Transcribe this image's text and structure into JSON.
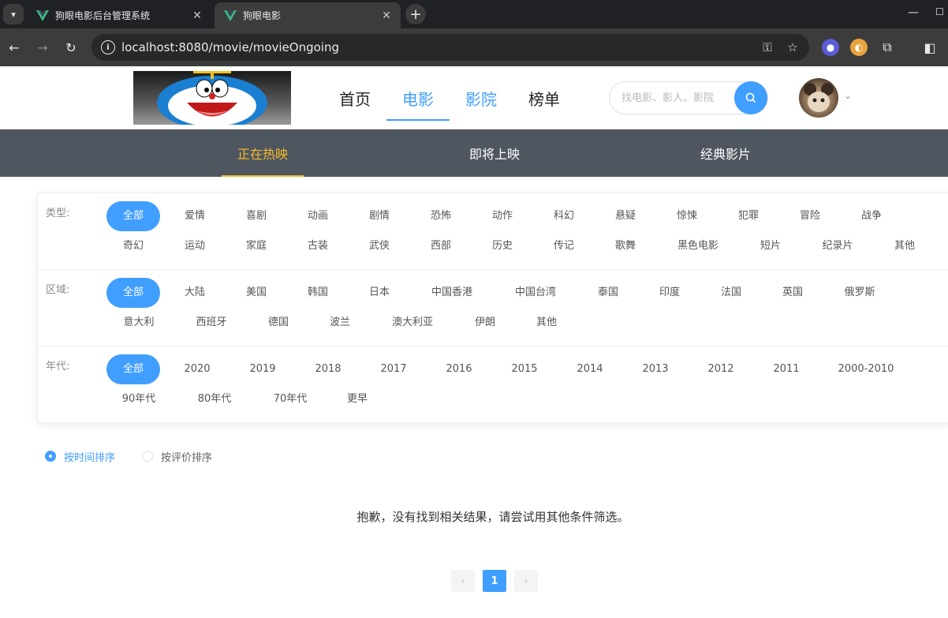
{
  "browser": {
    "tabs": [
      {
        "title": "狗眼电影后台管理系统",
        "active": false
      },
      {
        "title": "狗眼电影",
        "active": true
      }
    ],
    "url": "localhost:8080/movie/movieOngoing",
    "icons": [
      "tab-search-icon",
      "vue-logo-icon",
      "close-icon",
      "new-tab-icon",
      "back-icon",
      "forward-icon",
      "reload-icon",
      "site-info-icon",
      "password-key-icon",
      "bookmark-star-icon",
      "extensions-icon",
      "side-panel-icon"
    ]
  },
  "header": {
    "nav": [
      {
        "label": "首页",
        "state": "normal"
      },
      {
        "label": "电影",
        "state": "active"
      },
      {
        "label": "影院",
        "state": "blue"
      },
      {
        "label": "榜单",
        "state": "normal"
      }
    ],
    "search_placeholder": "找电影、影人、影院"
  },
  "sub_nav": [
    {
      "label": "正在热映",
      "active": true
    },
    {
      "label": "即将上映",
      "active": false
    },
    {
      "label": "经典影片",
      "active": false
    }
  ],
  "filters": {
    "type": {
      "label": "类型:",
      "tags": [
        "全部",
        "爱情",
        "喜剧",
        "动画",
        "剧情",
        "恐怖",
        "动作",
        "科幻",
        "悬疑",
        "惊悚",
        "犯罪",
        "冒险",
        "战争",
        "奇幻",
        "运动",
        "家庭",
        "古装",
        "武侠",
        "西部",
        "历史",
        "传记",
        "歌舞",
        "黑色电影",
        "短片",
        "纪录片",
        "其他"
      ],
      "selected": "全部"
    },
    "region": {
      "label": "区域:",
      "tags": [
        "全部",
        "大陆",
        "美国",
        "韩国",
        "日本",
        "中国香港",
        "中国台湾",
        "泰国",
        "印度",
        "法国",
        "英国",
        "俄罗斯",
        "意大利",
        "西班牙",
        "德国",
        "波兰",
        "澳大利亚",
        "伊朗",
        "其他"
      ],
      "selected": "全部"
    },
    "year": {
      "label": "年代:",
      "tags": [
        "全部",
        "2020",
        "2019",
        "2018",
        "2017",
        "2016",
        "2015",
        "2014",
        "2013",
        "2012",
        "2011",
        "2000-2010",
        "90年代",
        "80年代",
        "70年代",
        "更早"
      ],
      "selected": "全部"
    }
  },
  "sort": {
    "options": [
      {
        "label": "按时间排序",
        "checked": true
      },
      {
        "label": "按评价排序",
        "checked": false
      }
    ]
  },
  "empty_message": "抱歉，没有找到相关结果，请尝试用其他条件筛选。",
  "pagination": {
    "current": "1",
    "prev": "‹",
    "next": "›"
  },
  "colors": {
    "accent": "#409eff",
    "subnav_bg": "#4f565f",
    "subnav_active": "#f7ba2a"
  }
}
